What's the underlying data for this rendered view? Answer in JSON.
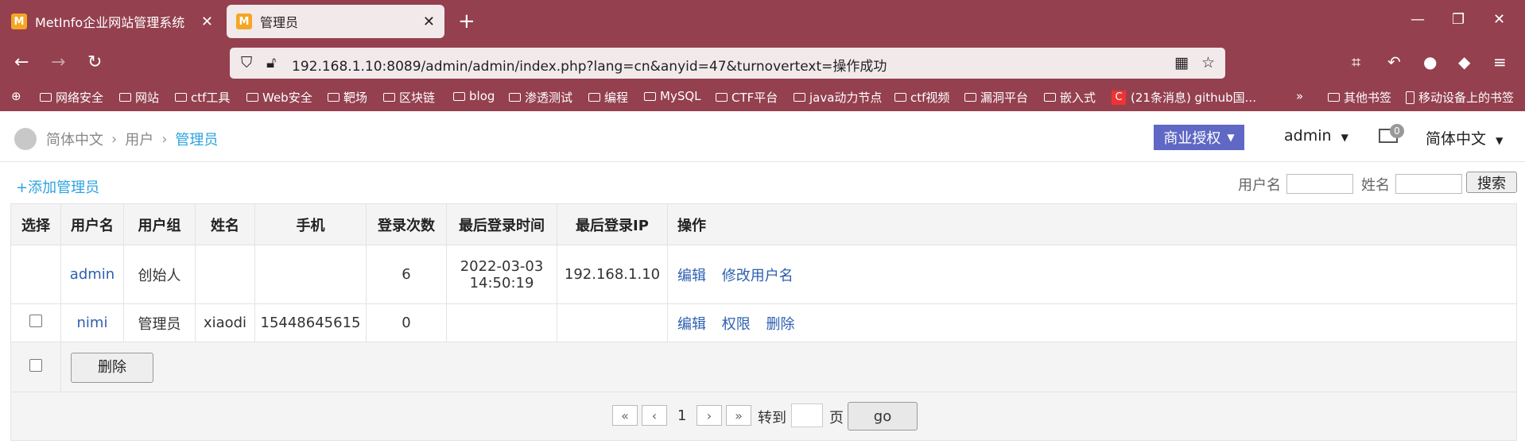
{
  "browser": {
    "tabs": [
      {
        "title": "MetInfo企业网站管理系统"
      },
      {
        "title": "管理员"
      }
    ],
    "favicon_letter": "M",
    "url": "192.168.1.10:8089/admin/admin/index.php?lang=cn&anyid=47&turnovertext=操作成功",
    "bookmarks": [
      "网络安全",
      "网站",
      "ctf工具",
      "Web安全",
      "靶场",
      "区块链",
      "blog",
      "渗透测试",
      "编程",
      "MySQL",
      "CTF平台",
      "java动力节点",
      "ctf视频",
      "漏洞平台",
      "嵌入式",
      "(21条消息) github国...",
      "其他书签",
      "移动设备上的书签"
    ]
  },
  "breadcrumb": [
    "简体中文",
    "用户",
    "管理员"
  ],
  "header": {
    "auth_label": "商业授权",
    "user_label": "admin",
    "mail_count": "0",
    "lang_label": "简体中文"
  },
  "toolbar": {
    "add_label": "+添加管理员",
    "username_label": "用户名",
    "name_label": "姓名",
    "search_label": "搜索"
  },
  "table": {
    "headers": [
      "选择",
      "用户名",
      "用户组",
      "姓名",
      "手机",
      "登录次数",
      "最后登录时间",
      "最后登录IP",
      "操作"
    ],
    "rows": [
      {
        "username": "admin",
        "group": "创始人",
        "name": "",
        "phone": "",
        "logins": "6",
        "last_time_date": "2022-03-03",
        "last_time_clock": "14:50:19",
        "last_ip": "192.168.1.10",
        "actions": [
          "编辑",
          "修改用户名"
        ]
      },
      {
        "username": "nimi",
        "group": "管理员",
        "name": "xiaodi",
        "phone": "15448645615",
        "logins": "0",
        "last_time_date": "",
        "last_time_clock": "",
        "last_ip": "",
        "actions": [
          "编辑",
          "权限",
          "删除"
        ]
      }
    ],
    "delete_label": "删除"
  },
  "pager": {
    "first": "«",
    "prev": "‹",
    "page": "1",
    "next": "›",
    "last": "»",
    "goto_label": "转到",
    "page_unit": "页",
    "go_label": "go"
  },
  "colors": {
    "chrome": "#94404f",
    "accent": "#2ba3e0",
    "link": "#2d5fb0",
    "auth_button": "#5f68c4"
  }
}
